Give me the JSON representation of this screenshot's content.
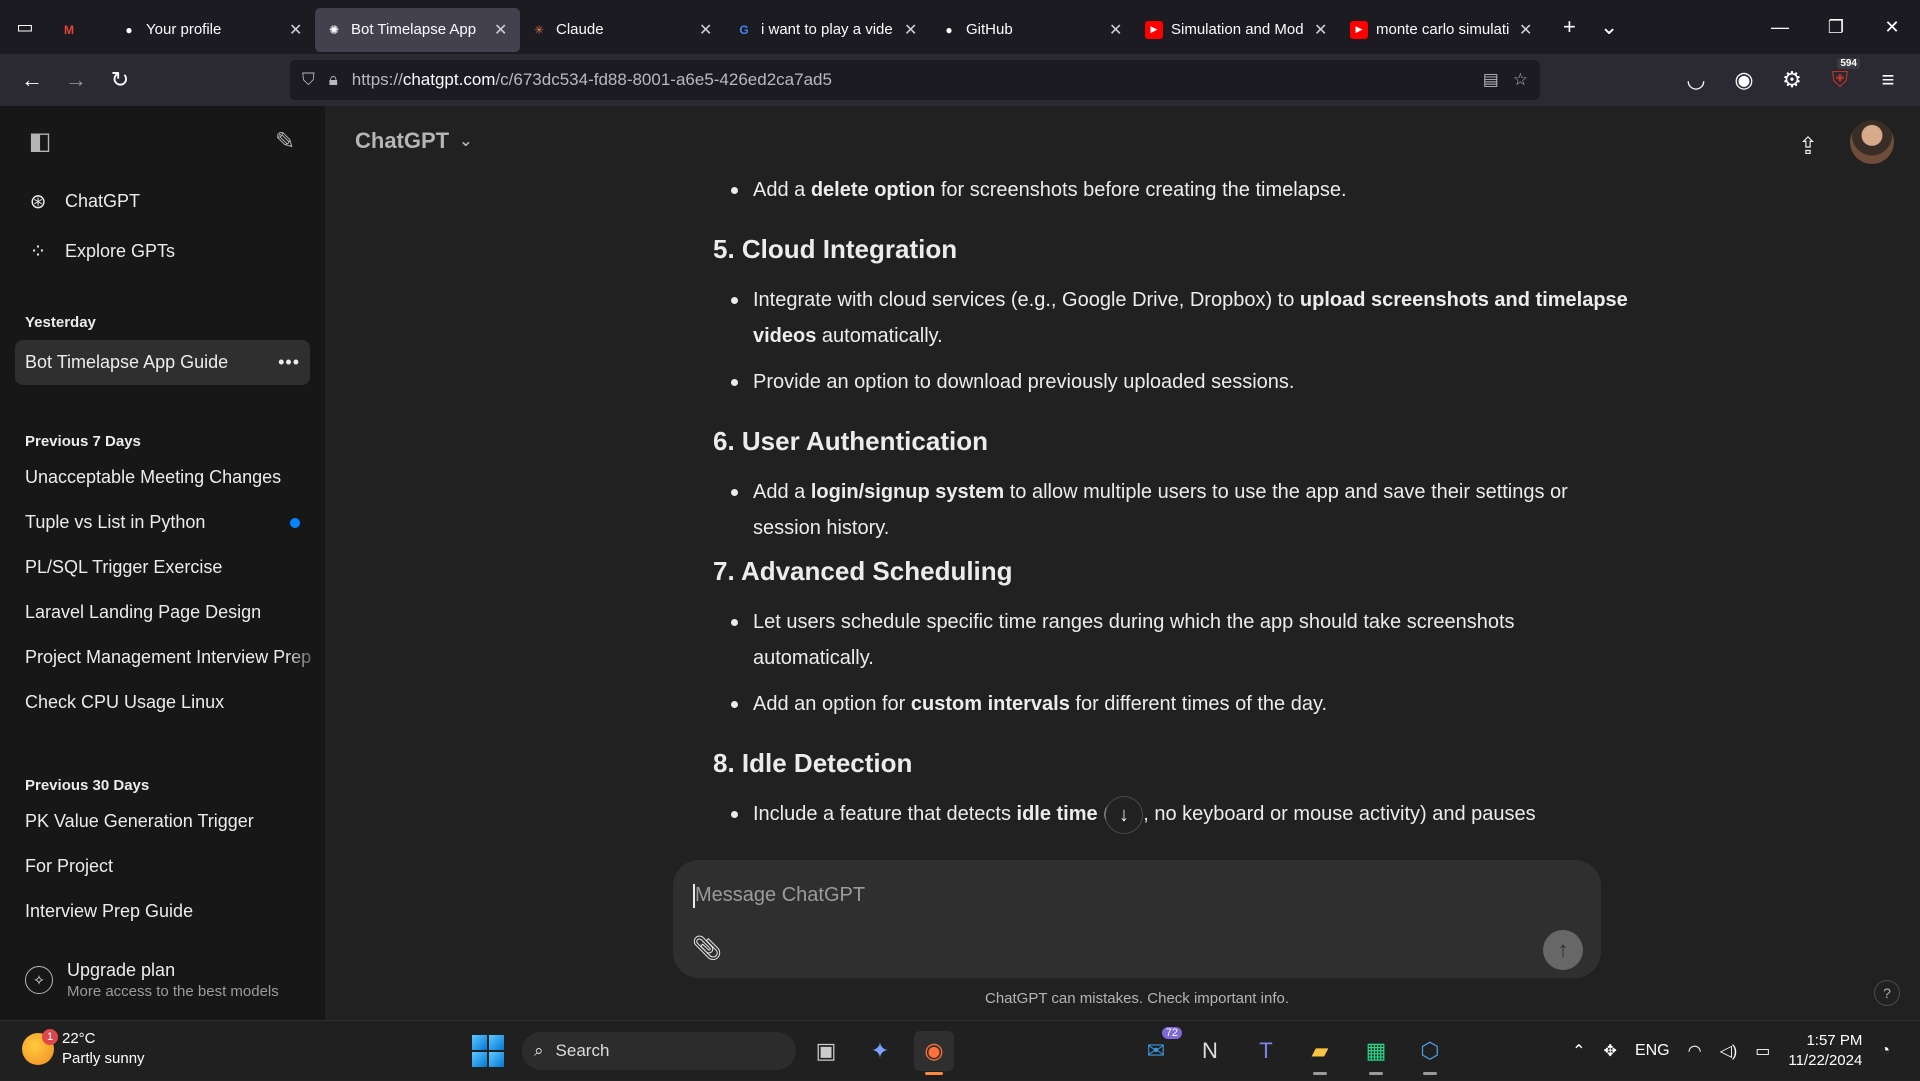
{
  "browser": {
    "tabs": [
      {
        "title": "",
        "icon": "gmail-icon",
        "color": "#ea4335",
        "small": true
      },
      {
        "title": "Your profile",
        "icon": "github-icon",
        "color": "#ffffff"
      },
      {
        "title": "Bot Timelapse App",
        "icon": "chatgpt-icon",
        "color": "#ffffff",
        "active": true
      },
      {
        "title": "Claude",
        "icon": "claude-icon",
        "color": "#d97757"
      },
      {
        "title": "i want to play a vide",
        "icon": "google-icon",
        "color": "#4285f4"
      },
      {
        "title": "GitHub",
        "icon": "github-icon",
        "color": "#ffffff"
      },
      {
        "title": "Simulation and Mod",
        "icon": "youtube-icon",
        "color": "#ff0000"
      },
      {
        "title": "monte carlo simulati",
        "icon": "youtube-icon",
        "color": "#ff0000"
      }
    ],
    "url_prefix": "https://",
    "url_domain": "chatgpt.com",
    "url_path": "/c/673dc534-fd88-8001-a6e5-426ed2ca7ad5",
    "extension_badge": "594"
  },
  "sidebar": {
    "links": [
      {
        "label": "ChatGPT",
        "icon": "chatgpt-logo-icon"
      },
      {
        "label": "Explore GPTs",
        "icon": "grid-icon"
      }
    ],
    "sections": [
      {
        "title": "Yesterday",
        "items": [
          {
            "label": "Bot Timelapse App Guide",
            "active": true
          }
        ]
      },
      {
        "title": "Previous 7 Days",
        "items": [
          {
            "label": "Unacceptable Meeting Changes"
          },
          {
            "label": "Tuple vs List in Python",
            "dot": true
          },
          {
            "label": "PL/SQL Trigger Exercise"
          },
          {
            "label": "Laravel Landing Page Design"
          },
          {
            "label": "Project Management Interview Prep"
          },
          {
            "label": "Check CPU Usage Linux"
          }
        ]
      },
      {
        "title": "Previous 30 Days",
        "items": [
          {
            "label": "PK Value Generation Trigger"
          },
          {
            "label": "For Project"
          },
          {
            "label": "Interview Prep Guide"
          }
        ]
      }
    ],
    "upgrade_title": "Upgrade plan",
    "upgrade_sub": "More access to the best models"
  },
  "header": {
    "model": "ChatGPT"
  },
  "message": {
    "blocks": [
      {
        "type": "bullet",
        "html_parts": [
          [
            "Add a ",
            false
          ],
          [
            "delete option",
            true
          ],
          [
            " for screenshots before creating the timelapse.",
            false
          ]
        ]
      },
      {
        "type": "heading",
        "text": "5. Cloud Integration"
      },
      {
        "type": "bullet",
        "html_parts": [
          [
            "Integrate with cloud services (e.g., Google Drive, Dropbox) to ",
            false
          ],
          [
            "upload screenshots and timelapse videos",
            true
          ],
          [
            " automatically.",
            false
          ]
        ]
      },
      {
        "type": "bullet",
        "html_parts": [
          [
            "Provide an option to download previously uploaded sessions.",
            false
          ]
        ]
      },
      {
        "type": "heading",
        "text": "6. User Authentication"
      },
      {
        "type": "bullet",
        "html_parts": [
          [
            "Add a ",
            false
          ],
          [
            "login/signup system",
            true
          ],
          [
            " to allow multiple users to use the app and save their settings or session history.",
            false
          ]
        ]
      },
      {
        "type": "heading",
        "text": "7. Advanced Scheduling"
      },
      {
        "type": "bullet",
        "html_parts": [
          [
            "Let users schedule specific time ranges during which the app should take screenshots automatically.",
            false
          ]
        ]
      },
      {
        "type": "bullet",
        "html_parts": [
          [
            "Add an option for ",
            false
          ],
          [
            "custom intervals",
            true
          ],
          [
            " for different times of the day.",
            false
          ]
        ]
      },
      {
        "type": "heading",
        "text": "8. Idle Detection"
      },
      {
        "type": "bullet",
        "html_parts": [
          [
            "Include a feature that detects ",
            false
          ],
          [
            "idle time",
            true
          ],
          [
            " (e.g., no keyboard or mouse activity) and pauses",
            false
          ]
        ]
      }
    ]
  },
  "composer": {
    "placeholder": "Message ChatGPT",
    "disclaimer": "ChatGPT can mistakes. Check important info."
  },
  "taskbar": {
    "weather_temp": "22°C",
    "weather_desc": "Partly sunny",
    "weather_badge": "1",
    "search_label": "Search",
    "mail_badge": "72",
    "lang": "ENG",
    "time": "1:57 PM",
    "date": "11/22/2024"
  }
}
